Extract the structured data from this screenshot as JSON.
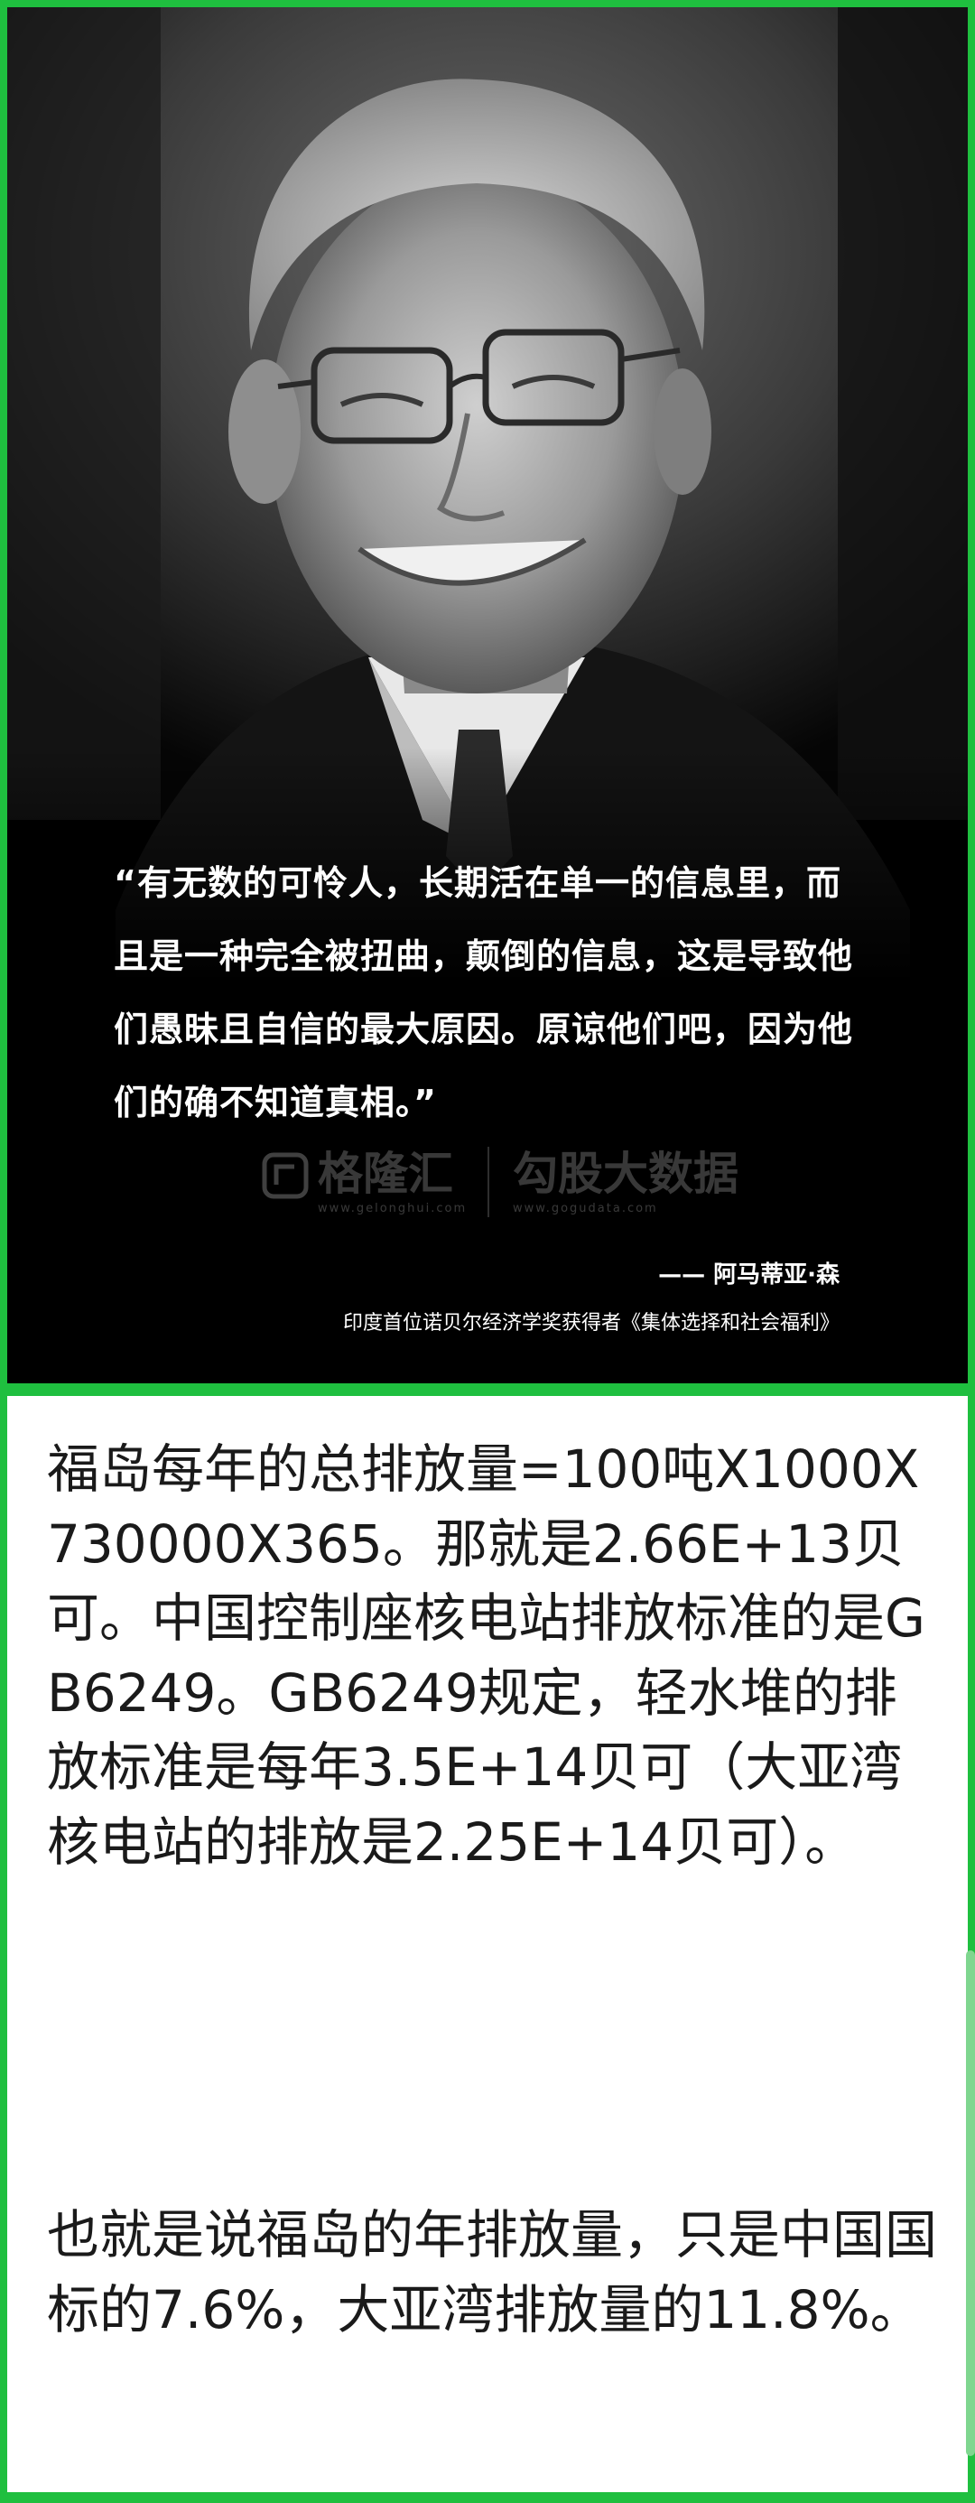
{
  "poster": {
    "quote": "“有无数的可怜人，长期活在单一的信息里，而且是一种完全被扭曲，颠倒的信息，这是导致他们愚昧且自信的最大原因。原谅他们吧，因为他们的确不知道真相。”",
    "attribution": "—— 阿马蒂亚·森",
    "affiliation": "印度首位诺贝尔经济学奖获得者《集体选择和社会福利》",
    "watermarks": [
      {
        "name": "格隆汇",
        "url": "www.gelonghui.com"
      },
      {
        "name": "勾股大数据",
        "url": "www.gogudata.com"
      }
    ]
  },
  "article": {
    "paragraphs": [
      "福岛每年的总排放量=100吨X1000X730000X365。那就是2.66E+13贝可。中国控制座核电站排放标准的是GB6249。GB6249规定，轻水堆的排放标准是每年3.5E+14贝可（大亚湾核电站的排放是2.25E+14贝可）。",
      "也就是说福岛的年排放量，只是中国国标的7.6%，大亚湾排放量的11.8%。"
    ]
  },
  "colors": {
    "frame_green": "#1fbf3f",
    "poster_background": "#000000",
    "text_white": "#ffffff",
    "article_text": "#1a1a1a"
  }
}
